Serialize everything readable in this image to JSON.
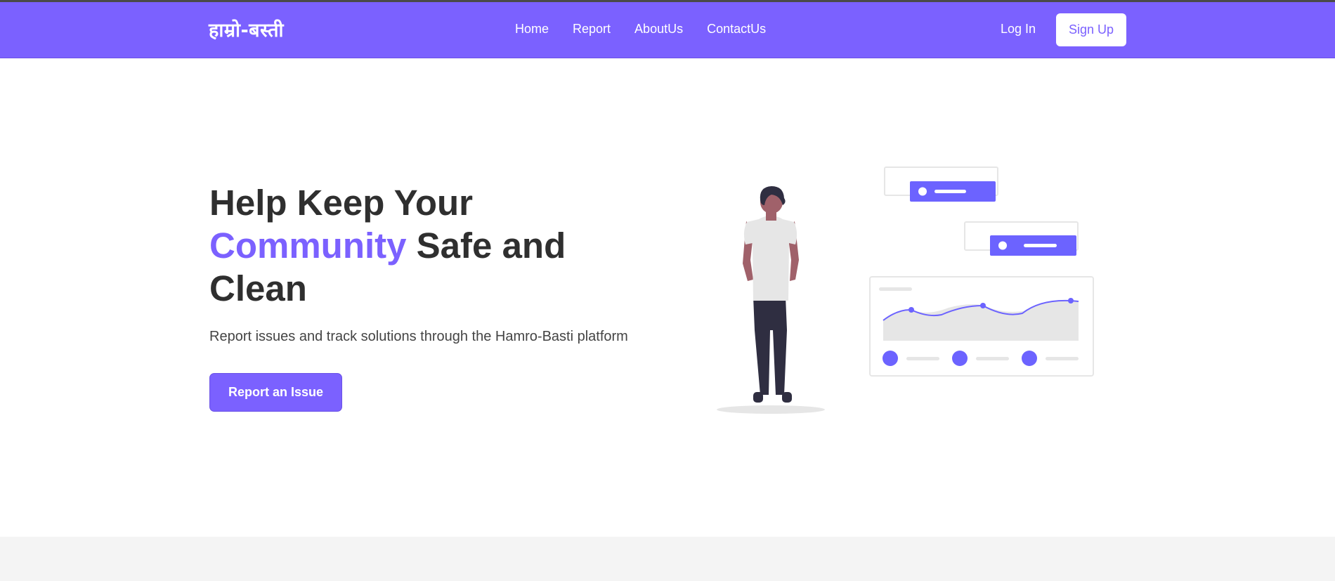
{
  "brand": {
    "name": "हाम्रो-बस्ती"
  },
  "nav": {
    "links": [
      "Home",
      "Report",
      "AboutUs",
      "ContactUs"
    ],
    "login_label": "Log In",
    "signup_label": "Sign Up"
  },
  "hero": {
    "title_line1": "Help Keep Your",
    "title_accent": "Community",
    "title_after_accent": " Safe and",
    "title_line3": "Clean",
    "subtitle": "Report issues and track solutions through the Hamro-Basti platform",
    "cta_label": "Report an Issue"
  },
  "colors": {
    "brand": "#7b61ff",
    "text_dark": "#2f2f2f",
    "text_muted": "#444444",
    "footer_band": "#f4f4f4"
  },
  "icons": {
    "illustration": "person-with-dashboard-illustration"
  }
}
